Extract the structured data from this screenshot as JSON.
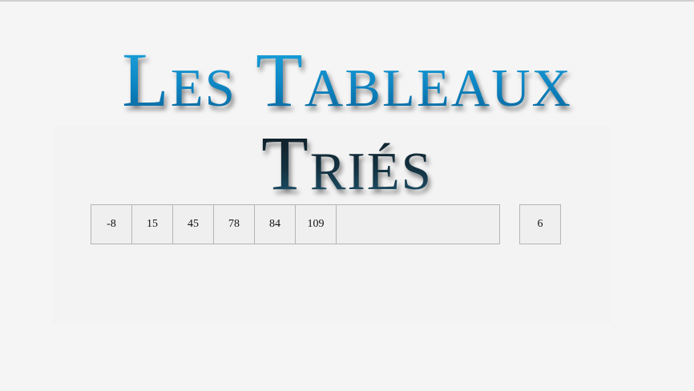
{
  "title": {
    "line1": "Les Tableaux",
    "line2": "Triés"
  },
  "sorted_array": {
    "values": [
      "-8",
      "15",
      "45",
      "78",
      "84",
      "109"
    ]
  },
  "input_value": "6"
}
